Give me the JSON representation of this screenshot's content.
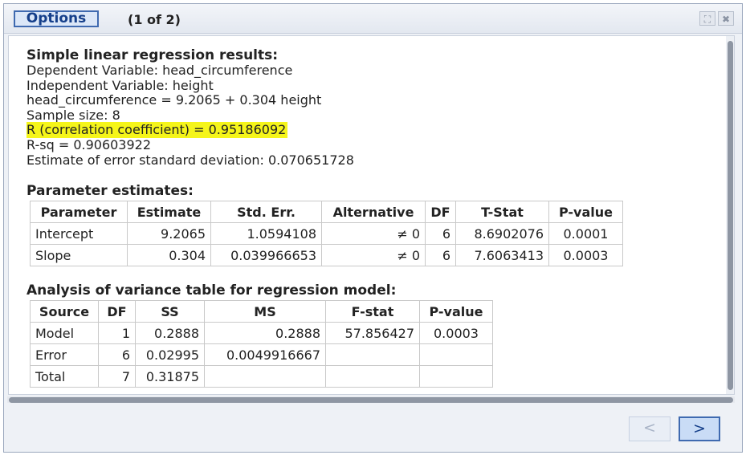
{
  "header": {
    "options_label": "Options",
    "pager_label": "(1 of 2)",
    "icons": [
      "expand-icon",
      "close-icon"
    ],
    "expand_glyph": "⛶",
    "close_glyph": "✖"
  },
  "results": {
    "title": "Simple linear regression results:",
    "lines": [
      "Dependent Variable: head_circumference",
      "Independent Variable: height",
      "head_circumference = 9.2065 + 0.304 height",
      "Sample size: 8",
      "R (correlation coefficient) = 0.95186092",
      "R-sq = 0.90603922",
      "Estimate of error standard deviation: 0.070651728"
    ],
    "highlight_color": "#f5f51a"
  },
  "parameter_estimates": {
    "title": "Parameter estimates:",
    "headers": [
      "Parameter",
      "Estimate",
      "Std. Err.",
      "Alternative",
      "DF",
      "T-Stat",
      "P-value"
    ],
    "rows": [
      [
        "Intercept",
        "9.2065",
        "1.0594108",
        "≠ 0",
        "6",
        "8.6902076",
        "0.0001"
      ],
      [
        "Slope",
        "0.304",
        "0.039966653",
        "≠ 0",
        "6",
        "7.6063413",
        "0.0003"
      ]
    ]
  },
  "anova": {
    "title": "Analysis of variance table for regression model:",
    "headers": [
      "Source",
      "DF",
      "SS",
      "MS",
      "F-stat",
      "P-value"
    ],
    "rows": [
      [
        "Model",
        "1",
        "0.2888",
        "0.2888",
        "57.856427",
        "0.0003"
      ],
      [
        "Error",
        "6",
        "0.02995",
        "0.0049916667",
        "",
        ""
      ],
      [
        "Total",
        "7",
        "0.31875",
        "",
        "",
        ""
      ]
    ]
  },
  "nav": {
    "prev_label": "<",
    "next_label": ">"
  },
  "colors": {
    "accent": "#3f6ab0",
    "accent_text": "#153f8a",
    "highlight": "#f5f51a"
  }
}
